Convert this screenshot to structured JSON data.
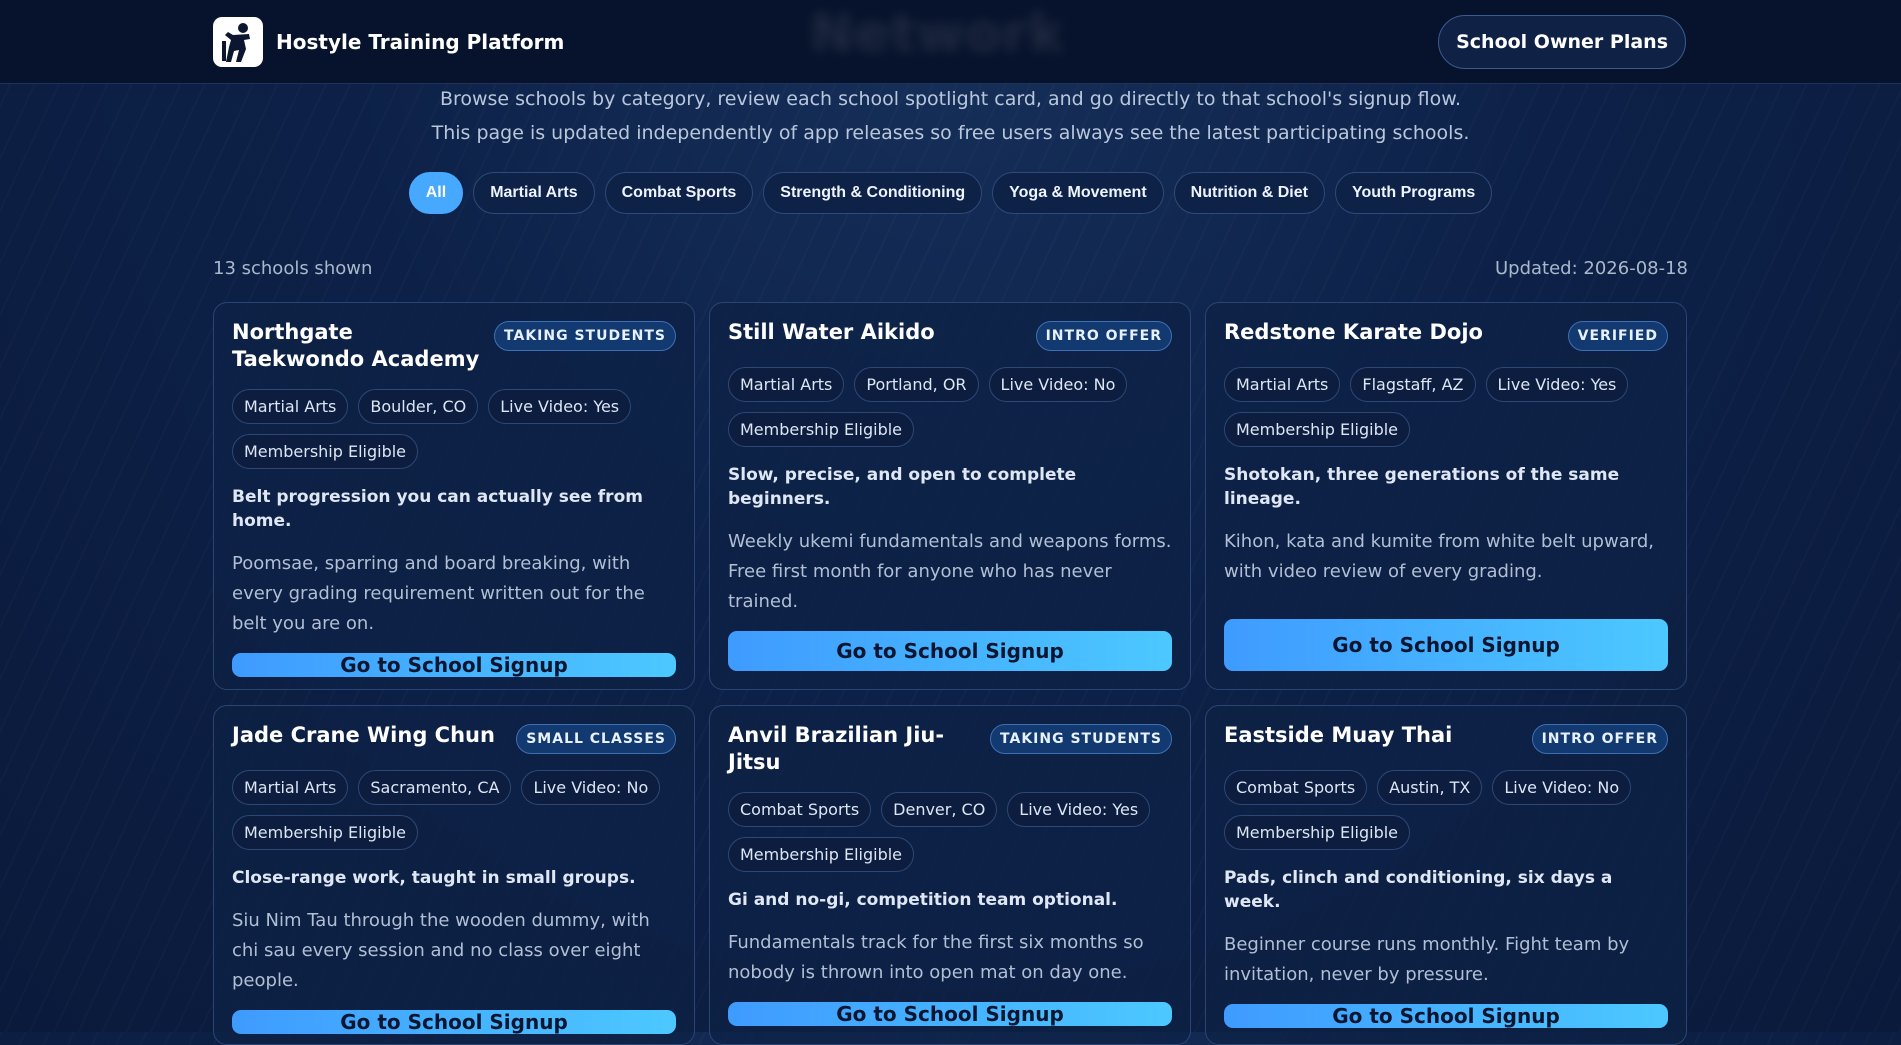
{
  "header": {
    "brand": "Hostyle Training Platform",
    "ghost_title": "Network",
    "owner_button": "School Owner Plans"
  },
  "intro": {
    "line1": "Browse schools by category, review each school spotlight card, and go directly to that school's signup flow.",
    "line2": "This page is updated independently of app releases so free users always see the latest participating schools."
  },
  "filters": [
    {
      "label": "All",
      "active": true
    },
    {
      "label": "Martial Arts",
      "active": false
    },
    {
      "label": "Combat Sports",
      "active": false
    },
    {
      "label": "Strength & Conditioning",
      "active": false
    },
    {
      "label": "Yoga & Movement",
      "active": false
    },
    {
      "label": "Nutrition & Diet",
      "active": false
    },
    {
      "label": "Youth Programs",
      "active": false
    }
  ],
  "meta": {
    "count": "13 schools shown",
    "updated": "Updated: 2026-08-18"
  },
  "cards": [
    {
      "title": "Northgate Taekwondo Academy",
      "badge": "TAKING STUDENTS",
      "tags": [
        "Martial Arts",
        "Boulder, CO",
        "Live Video: Yes",
        "Membership Eligible"
      ],
      "tagline": "Belt progression you can actually see from home.",
      "desc": "Poomsae, sparring and board breaking, with every grading requirement written out for the belt you are on.",
      "button": "Go to School Signup"
    },
    {
      "title": "Still Water Aikido",
      "badge": "INTRO OFFER",
      "tags": [
        "Martial Arts",
        "Portland, OR",
        "Live Video: No",
        "Membership Eligible"
      ],
      "tagline": "Slow, precise, and open to complete beginners.",
      "desc": "Weekly ukemi fundamentals and weapons forms. Free first month for anyone who has never trained.",
      "button": "Go to School Signup"
    },
    {
      "title": "Redstone Karate Dojo",
      "badge": "VERIFIED",
      "tags": [
        "Martial Arts",
        "Flagstaff, AZ",
        "Live Video: Yes",
        "Membership Eligible"
      ],
      "tagline": "Shotokan, three generations of the same lineage.",
      "desc": "Kihon, kata and kumite from white belt upward, with video review of every grading.",
      "button": "Go to School Signup"
    },
    {
      "title": "Jade Crane Wing Chun",
      "badge": "SMALL CLASSES",
      "tags": [
        "Martial Arts",
        "Sacramento, CA",
        "Live Video: No",
        "Membership Eligible"
      ],
      "tagline": "Close-range work, taught in small groups.",
      "desc": "Siu Nim Tau through the wooden dummy, with chi sau every session and no class over eight people.",
      "button": "Go to School Signup"
    },
    {
      "title": "Anvil Brazilian Jiu-Jitsu",
      "badge": "TAKING STUDENTS",
      "tags": [
        "Combat Sports",
        "Denver, CO",
        "Live Video: Yes",
        "Membership Eligible"
      ],
      "tagline": "Gi and no-gi, competition team optional.",
      "desc": "Fundamentals track for the first six months so nobody is thrown into open mat on day one.",
      "button": "Go to School Signup"
    },
    {
      "title": "Eastside Muay Thai",
      "badge": "INTRO OFFER",
      "tags": [
        "Combat Sports",
        "Austin, TX",
        "Live Video: No",
        "Membership Eligible"
      ],
      "tagline": "Pads, clinch and conditioning, six days a week.",
      "desc": "Beginner course runs monthly. Fight team by invitation, never by pressure.",
      "button": "Go to School Signup"
    }
  ]
}
